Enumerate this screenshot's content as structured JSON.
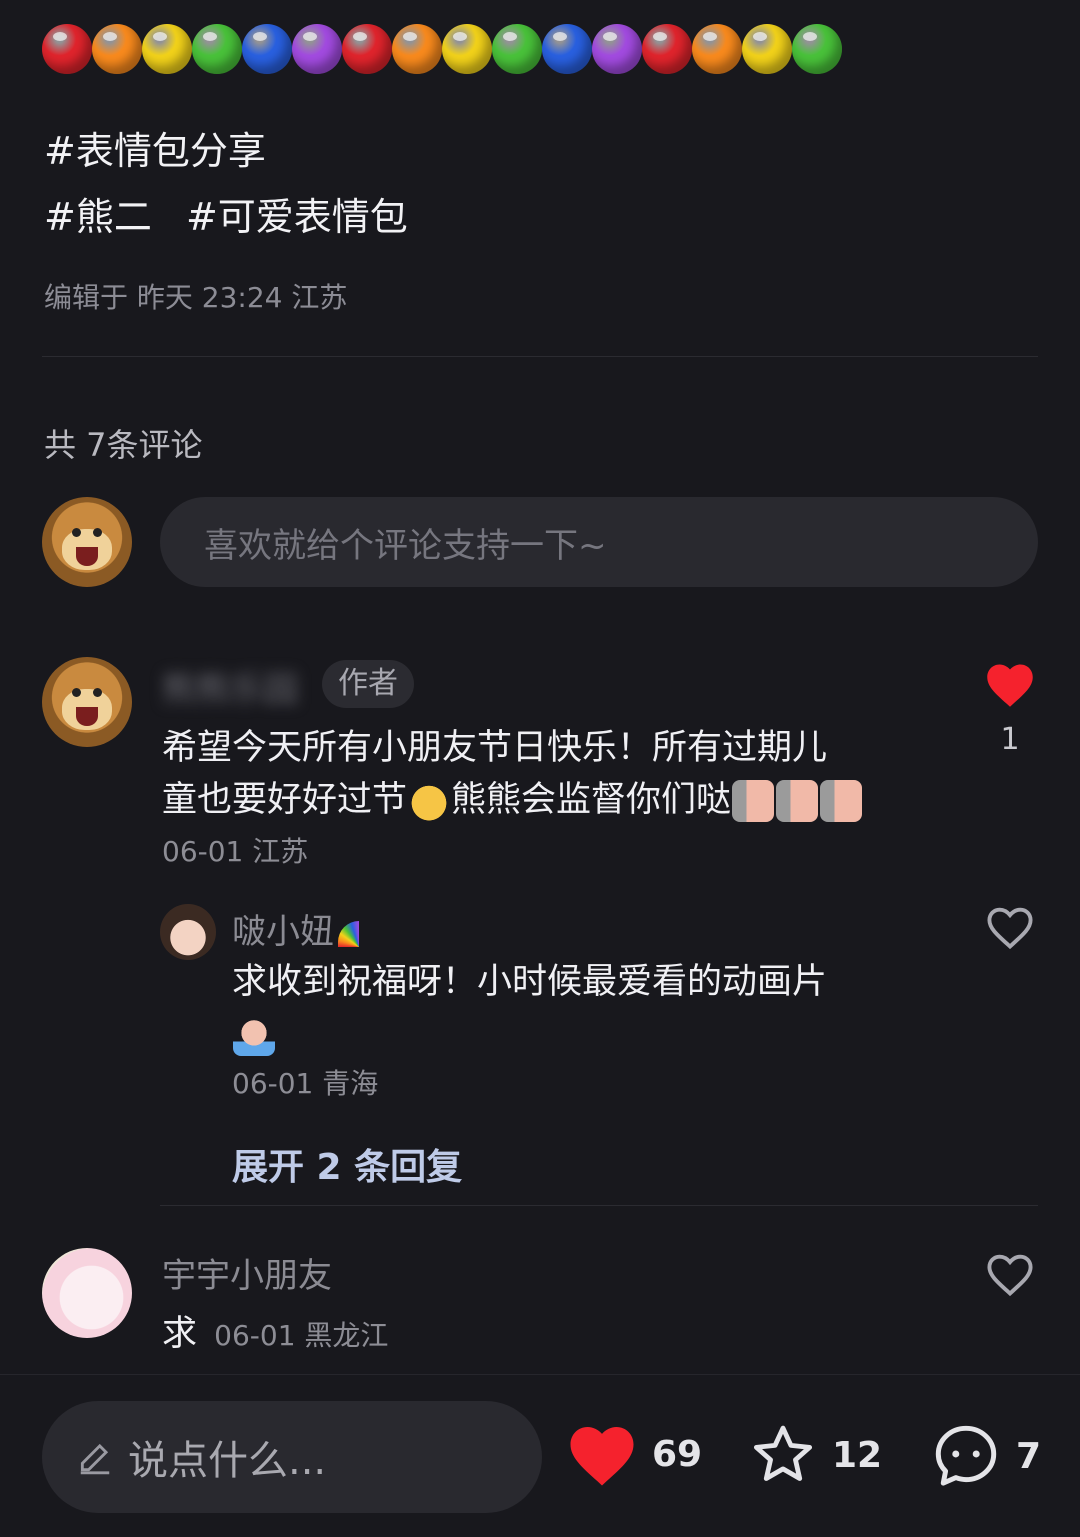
{
  "decoration": {
    "ball_colors": [
      "#e0242c",
      "#f98a1d",
      "#f2d21a",
      "#49c23a",
      "#2960e0",
      "#a24be0",
      "#e0242c",
      "#f98a1d",
      "#f2d21a",
      "#49c23a",
      "#2960e0",
      "#a24be0",
      "#e0242c",
      "#f98a1d",
      "#f2d21a",
      "#49c23a"
    ]
  },
  "post": {
    "tags_line1": [
      "#表情包分享"
    ],
    "tags_line2": [
      "#熊二",
      "#可爱表情包"
    ],
    "edited": "编辑于 昨天 23:24 江苏"
  },
  "comments_header": "共 7条评论",
  "comment_input": {
    "placeholder": "喜欢就给个评论支持一下~"
  },
  "comments": [
    {
      "username": "熊熊乐园",
      "badge": "作者",
      "text_line1": "希望今天所有小朋友节日快乐！所有过期儿",
      "text_line2a": "童也要好好过节",
      "text_line2b": "熊熊会监督你们哒",
      "meta": "06-01 江苏",
      "likes": "1",
      "liked": true
    },
    {
      "username": "啵小妞",
      "text": "求收到祝福呀！小时候最爱看的动画片",
      "meta": "06-01 青海",
      "liked": false
    },
    {
      "username": "宇宇小朋友",
      "text": "求",
      "meta": "06-01 黑龙江",
      "liked": false
    }
  ],
  "expand_replies": "展开 2 条回复",
  "bottom_bar": {
    "input_placeholder": "说点什么...",
    "likes": "69",
    "favorites": "12",
    "comments": "7"
  },
  "colors": {
    "like_red": "#f5222d",
    "background": "#18181d"
  }
}
